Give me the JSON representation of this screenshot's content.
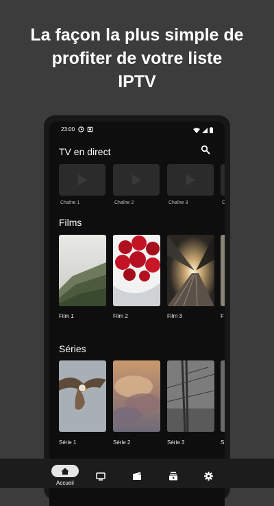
{
  "headline": {
    "line1": "La façon la plus simple de",
    "line2": "profiter de votre liste",
    "line3": "IPTV"
  },
  "statusbar": {
    "time": "23:00"
  },
  "live": {
    "title": "TV en direct",
    "channels": [
      "Chaîne 1",
      "Chaîne 2",
      "Chaîne 3",
      "C"
    ]
  },
  "movies": {
    "title": "Films",
    "items": [
      "Film 1",
      "Film 2",
      "Film 3",
      "F"
    ]
  },
  "series": {
    "title": "Séries",
    "items": [
      "Série 1",
      "Série 2",
      "Série 3",
      "S"
    ]
  },
  "nav": {
    "home_label": "Accueil",
    "icons": [
      "home-icon",
      "tv-icon",
      "movie-icon",
      "subscriptions-icon",
      "settings-icon"
    ]
  },
  "colors": {
    "background": "#3c3c3c",
    "phone": "#181818",
    "screen": "#0e0e0e",
    "nav": "#1c1c1c"
  }
}
